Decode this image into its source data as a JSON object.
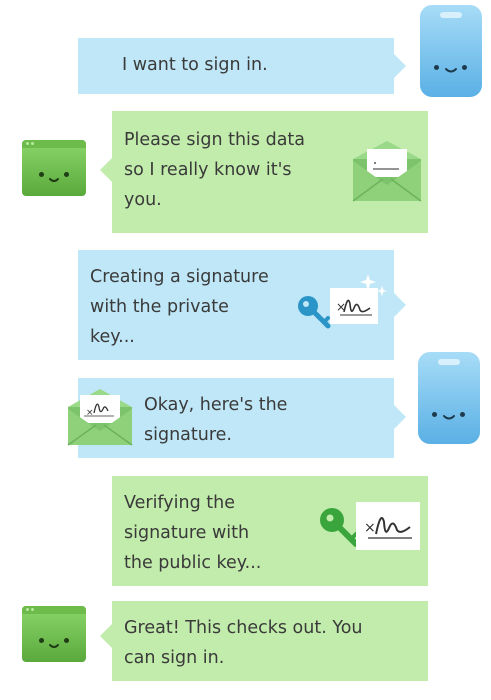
{
  "messages": [
    {
      "id": "sign-in-request",
      "text_lines": [
        "I want to sign in."
      ]
    },
    {
      "id": "please-sign",
      "text_lines": [
        "Please sign this data",
        "so I really know it's",
        "you."
      ]
    },
    {
      "id": "creating-signature",
      "text_lines": [
        "Creating a signature",
        "with the private",
        "key..."
      ]
    },
    {
      "id": "heres-signature",
      "text_lines": [
        "Okay, here's the",
        "signature."
      ]
    },
    {
      "id": "verifying",
      "text_lines": [
        "Verifying the",
        "signature with",
        "the public key..."
      ]
    },
    {
      "id": "great",
      "text_lines": [
        "Great! This checks out. You",
        "can sign in."
      ]
    }
  ],
  "signature_mark": "×",
  "colors": {
    "client_bubble": "#bfe7f7",
    "server_bubble": "#c2ecab",
    "phone": "#5ab0e5",
    "server": "#5aa93d",
    "private_key": "#2b95c8",
    "public_key": "#3aa43d",
    "envelope": "#7dc36b"
  },
  "icons": [
    "phone-icon",
    "server-window-icon",
    "envelope-icon",
    "private-key-icon",
    "public-key-icon",
    "signature-card-icon",
    "sparkle-icon"
  ]
}
